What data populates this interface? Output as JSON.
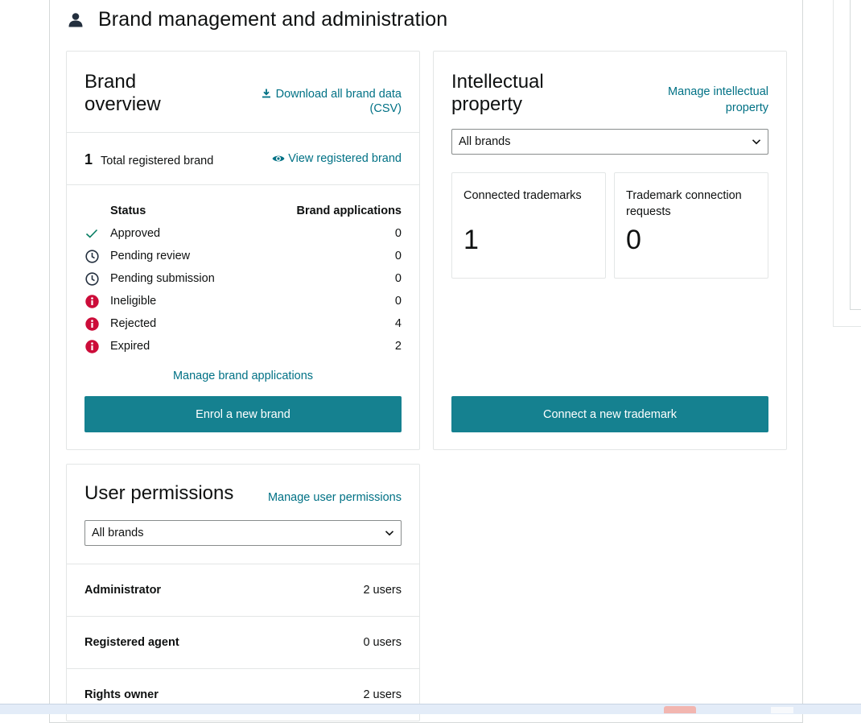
{
  "section": {
    "title": "Brand management and administration",
    "icon": "person-icon"
  },
  "brand_overview": {
    "title": "Brand overview",
    "download_link": "Download all brand data (CSV)",
    "total_count": "1",
    "total_label": "Total registered brand",
    "view_link": "View registered brand",
    "col_status": "Status",
    "col_apps": "Brand applications",
    "rows": [
      {
        "label": "Approved",
        "value": "0",
        "icon": "check-icon"
      },
      {
        "label": "Pending review",
        "value": "0",
        "icon": "clock-icon"
      },
      {
        "label": "Pending submission",
        "value": "0",
        "icon": "clock-icon"
      },
      {
        "label": "Ineligible",
        "value": "0",
        "icon": "info-alert-icon"
      },
      {
        "label": "Rejected",
        "value": "4",
        "icon": "info-alert-icon"
      },
      {
        "label": "Expired",
        "value": "2",
        "icon": "info-alert-icon"
      }
    ],
    "manage_link": "Manage brand applications",
    "enrol_button": "Enrol a new brand"
  },
  "intellectual_property": {
    "title": "Intellectual property",
    "manage_link": "Manage intellectual property",
    "select_value": "All brands",
    "connected_label": "Connected trademarks",
    "connected_value": "1",
    "requests_label": "Trademark connection requests",
    "requests_value": "0",
    "connect_button": "Connect a new trademark"
  },
  "user_permissions": {
    "title": "User permissions",
    "manage_link": "Manage user permissions",
    "select_value": "All brands",
    "rows": [
      {
        "role": "Administrator",
        "count": "2 users"
      },
      {
        "role": "Registered agent",
        "count": "0 users"
      },
      {
        "role": "Rights owner",
        "count": "2 users"
      }
    ]
  },
  "colors": {
    "accent": "#158190",
    "link": "#007185",
    "alert": "#cc0c39",
    "success": "#067d62"
  }
}
